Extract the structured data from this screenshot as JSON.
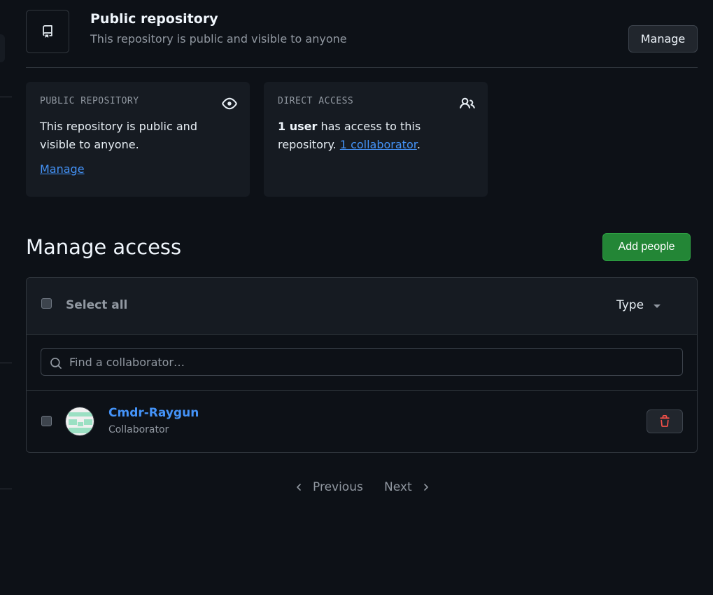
{
  "header": {
    "title": "Public repository",
    "subtitle": "This repository is public and visible to anyone",
    "manage_label": "Manage",
    "icon": "repo-icon"
  },
  "cards": {
    "public": {
      "label": "PUBLIC REPOSITORY",
      "icon": "eye-icon",
      "text": "This repository is public and visible to anyone.",
      "link": "Manage"
    },
    "access": {
      "label": "DIRECT ACCESS",
      "icon": "people-icon",
      "count_bold": "1 user",
      "text_mid": " has access to this repository. ",
      "link": "1 collaborator",
      "text_end": "."
    }
  },
  "manage_access": {
    "title": "Manage access",
    "add_label": "Add people",
    "select_all": "Select all",
    "type_filter": "Type",
    "search_placeholder": "Find a collaborator…"
  },
  "members": [
    {
      "name": "Cmdr-Raygun",
      "role": "Collaborator"
    }
  ],
  "pagination": {
    "previous": "Previous",
    "next": "Next"
  },
  "colors": {
    "background": "#0d1117",
    "card": "#161b22",
    "border": "#30363d",
    "link": "#4493f8",
    "primary_button": "#238636",
    "danger": "#f85149"
  }
}
